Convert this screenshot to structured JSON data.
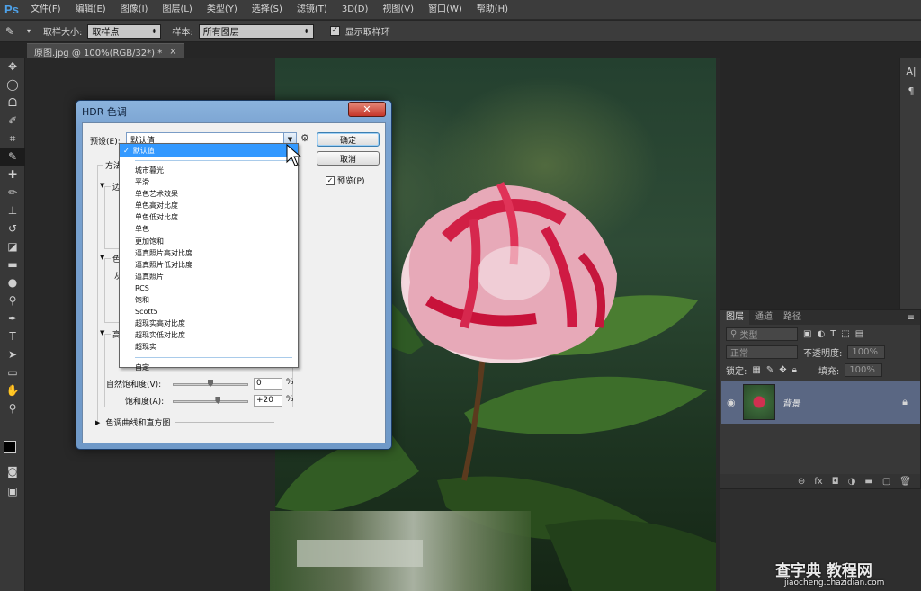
{
  "app": {
    "logo": "Ps"
  },
  "menu": [
    "文件(F)",
    "编辑(E)",
    "图像(I)",
    "图层(L)",
    "类型(Y)",
    "选择(S)",
    "滤镜(T)",
    "3D(D)",
    "视图(V)",
    "窗口(W)",
    "帮助(H)"
  ],
  "options": {
    "sample_size_label": "取样大小:",
    "sample_size_value": "取样点",
    "sample_label": "样本:",
    "sample_value": "所有图层",
    "show_ring_label": "显示取样环",
    "show_ring_checked": true
  },
  "doc_tab": {
    "title": "原图.jpg @ 100%(RGB/32*) *",
    "close": "×"
  },
  "dialog": {
    "title": "HDR 色调",
    "close": "✕",
    "preset_label": "预设(E):",
    "preset_value": "默认值",
    "ok": "确定",
    "cancel": "取消",
    "preview_label": "预览(P)",
    "preview_checked": true,
    "method_label": "方法",
    "group1": "边",
    "group2": "色",
    "group2_sub": "灰",
    "group3": "高",
    "vibrance_label": "自然饱和度(V):",
    "vibrance_value": "0",
    "vibrance_level": 0,
    "saturation_label": "饱和度(A):",
    "saturation_value": "+20",
    "saturation_level": 20,
    "percent": "%",
    "histogram_label": "色调曲线和直方图"
  },
  "preset_list": {
    "selected": "默认值",
    "items": [
      "城市暮光",
      "平滑",
      "单色艺术效果",
      "单色高对比度",
      "单色低对比度",
      "单色",
      "更加饱和",
      "逼真照片高对比度",
      "逼真照片低对比度",
      "逼真照片",
      "RCS",
      "饱和",
      "Scott5",
      "超现实高对比度",
      "超现实低对比度",
      "超现实"
    ],
    "custom": "自定"
  },
  "layers_panel": {
    "tabs": [
      "图层",
      "通道",
      "路径"
    ],
    "kind_label": "类型",
    "blend_mode": "正常",
    "opacity_label": "不透明度:",
    "opacity_value": "100%",
    "lock_label": "锁定:",
    "fill_label": "填充:",
    "fill_value": "100%",
    "layer_name": "背景"
  },
  "watermark": {
    "brand": "查字典 教程网",
    "url": "jiaocheng.chazidian.com"
  },
  "colors": {
    "menubar": "#3c3c3c",
    "dialog_frame": "#7aa3d1",
    "selection": "#3399ff",
    "layer_selected": "#5a6783"
  }
}
